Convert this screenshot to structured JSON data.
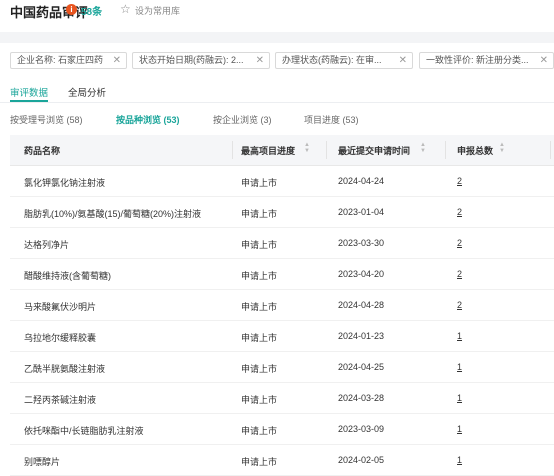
{
  "header": {
    "title": "中国药品审评",
    "info_icon": "i",
    "count": "58条",
    "favorite_label": "设为常用库"
  },
  "filters": [
    {
      "label": "企业名称: 石家庄四药"
    },
    {
      "label": "状态开始日期(药融云): 2..."
    },
    {
      "label": "办理状态(药融云): 在审..."
    },
    {
      "label": "一致性评价: 新注册分类..."
    }
  ],
  "tabs": [
    {
      "label": "审评数据",
      "active": true
    },
    {
      "label": "全局分析",
      "active": false
    }
  ],
  "subtabs": [
    {
      "label": "按受理号浏览 (58)",
      "active": false
    },
    {
      "label": "按品种浏览 (53)",
      "active": true
    },
    {
      "label": "按企业浏览 (3)",
      "active": false
    },
    {
      "label": "项目进度 (53)",
      "active": false
    }
  ],
  "table": {
    "columns": [
      "药品名称",
      "最高项目进度",
      "最近提交申请时间",
      "申报总数"
    ],
    "rows": [
      {
        "name": "氯化钾氯化钠注射液",
        "progress": "申请上市",
        "date": "2024-04-24",
        "count": "2"
      },
      {
        "name": "脂肪乳(10%)/氨基酸(15)/葡萄糖(20%)注射液",
        "progress": "申请上市",
        "date": "2023-01-04",
        "count": "2"
      },
      {
        "name": "达格列净片",
        "progress": "申请上市",
        "date": "2023-03-30",
        "count": "2"
      },
      {
        "name": "醋酸维持液(含葡萄糖)",
        "progress": "申请上市",
        "date": "2023-04-20",
        "count": "2"
      },
      {
        "name": "马来酸氟伏沙明片",
        "progress": "申请上市",
        "date": "2024-04-28",
        "count": "2"
      },
      {
        "name": "乌拉地尔缓释胶囊",
        "progress": "申请上市",
        "date": "2024-01-23",
        "count": "1"
      },
      {
        "name": "乙酰半胱氨酸注射液",
        "progress": "申请上市",
        "date": "2024-04-25",
        "count": "1"
      },
      {
        "name": "二羟丙茶碱注射液",
        "progress": "申请上市",
        "date": "2024-03-28",
        "count": "1"
      },
      {
        "name": "依托咪酯中/长链脂肪乳注射液",
        "progress": "申请上市",
        "date": "2023-03-09",
        "count": "1"
      },
      {
        "name": "别嘌醇片",
        "progress": "申请上市",
        "date": "2024-02-05",
        "count": "1"
      }
    ]
  },
  "colors": {
    "accent": "#1aa59a",
    "info_icon": "#e8541f",
    "header_bg": "#f5f6f8"
  },
  "icons": [
    "info-icon",
    "star-icon",
    "close-icon",
    "sort-icon"
  ]
}
